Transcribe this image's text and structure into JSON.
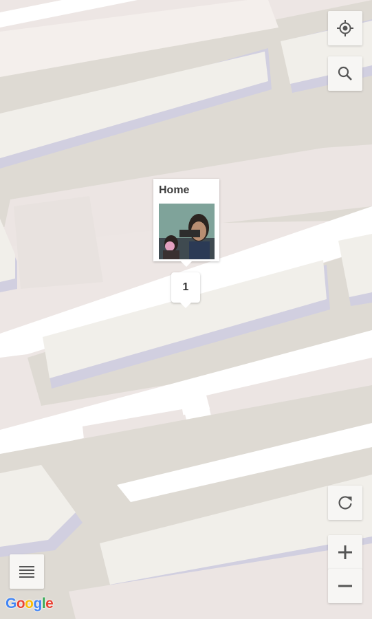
{
  "map": {
    "colors": {
      "ground": "#ede6e4",
      "road": "#ffffff",
      "sidewalk": "#dedad3",
      "building_top": "#f1efea",
      "building_side": "#d1cfe0"
    }
  },
  "marker": {
    "title": "Home",
    "photo_icon": "person-photo-thumbnail",
    "photo_badge": "▪▪",
    "cluster_count": "1"
  },
  "controls": {
    "locate_icon": "my-location-icon",
    "search_icon": "search-icon",
    "refresh_icon": "refresh-icon",
    "zoom_in_label": "+",
    "zoom_out_label": "−",
    "layers_icon": "menu-icon"
  },
  "attribution": {
    "logo_text": "Google",
    "logo_colors": [
      "#4285F4",
      "#EA4335",
      "#FBBC05",
      "#4285F4",
      "#34A853",
      "#EA4335"
    ]
  }
}
